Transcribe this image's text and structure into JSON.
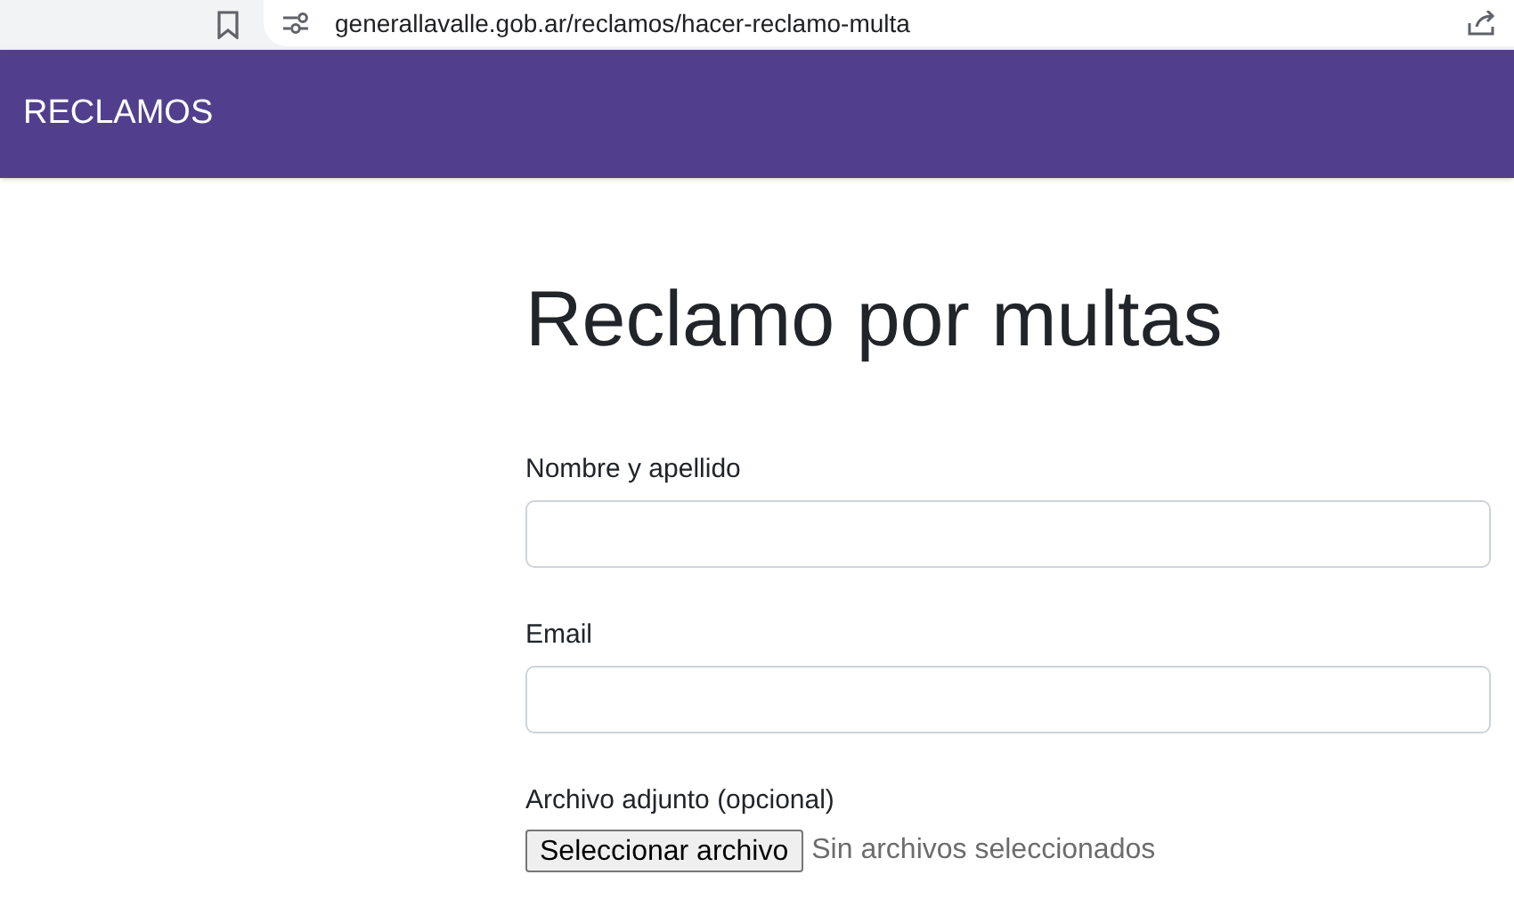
{
  "browser": {
    "url": "generallavalle.gob.ar/reclamos/hacer-reclamo-multa"
  },
  "header": {
    "title": "RECLAMOS"
  },
  "form": {
    "title": "Reclamo por multas",
    "fields": [
      {
        "kind": "text",
        "label": "Nombre y apellido"
      },
      {
        "kind": "text",
        "label": "Email"
      },
      {
        "kind": "file",
        "label": "Archivo adjunto (opcional)",
        "button": "Seleccionar archivo",
        "status": "Sin archivos seleccionados"
      }
    ]
  }
}
